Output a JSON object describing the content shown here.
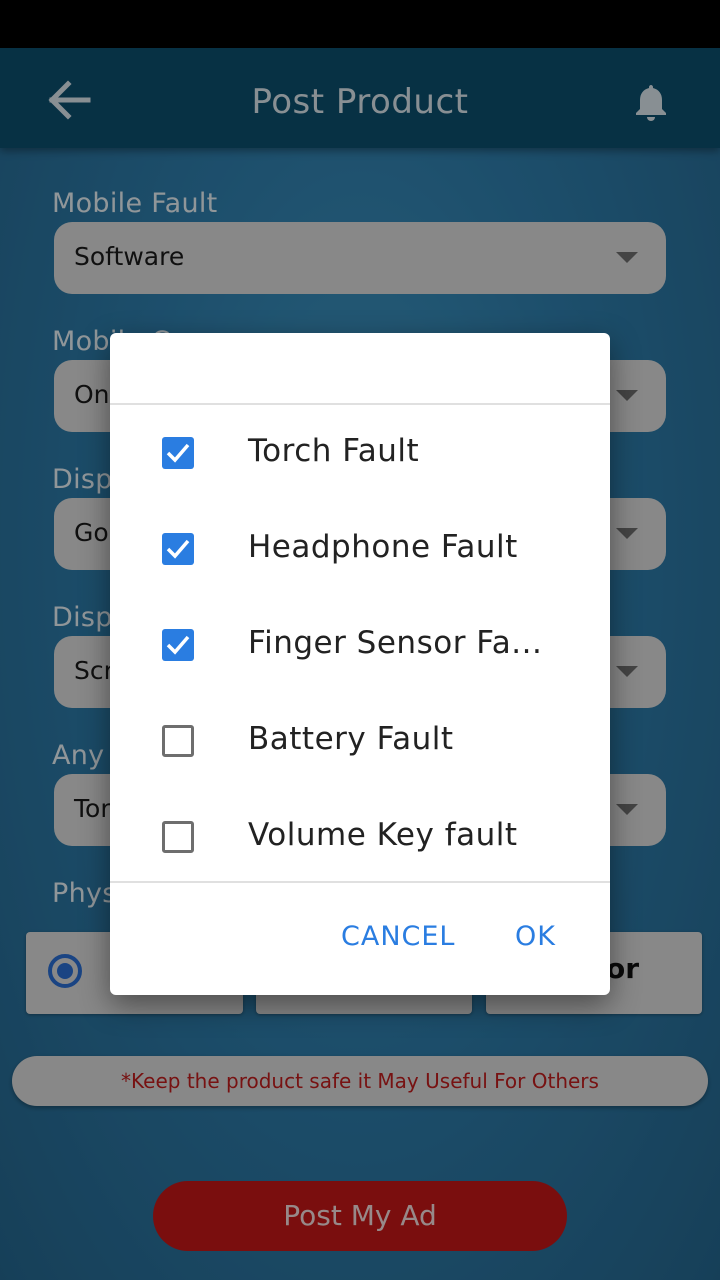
{
  "header": {
    "title": "Post Product"
  },
  "form": {
    "fields": [
      {
        "label": "Mobile Fault",
        "value": "Software"
      },
      {
        "label": "Mobile C",
        "value": "On"
      },
      {
        "label": "Disp",
        "value": "Go"
      },
      {
        "label": "Disp",
        "value": "Scr"
      },
      {
        "label": "Any",
        "value": "Tor"
      }
    ],
    "physical_label": "Phys",
    "radio_partial_text": "or"
  },
  "note": "*Keep the product safe it May Useful For Others",
  "post_button": "Post My Ad",
  "dialog": {
    "items": [
      {
        "label": "Torch Fault",
        "checked": true
      },
      {
        "label": "Headphone Fault",
        "checked": true
      },
      {
        "label": "Finger Sensor Fa...",
        "checked": true
      },
      {
        "label": "Battery Fault",
        "checked": false
      },
      {
        "label": "Volume Key fault",
        "checked": false
      }
    ],
    "cancel": "CANCEL",
    "ok": "OK"
  },
  "colors": {
    "appbar": "#0c4f6e",
    "accent": "#2a7de1",
    "post_button": "#c51818",
    "note_text": "#c11d1d"
  }
}
